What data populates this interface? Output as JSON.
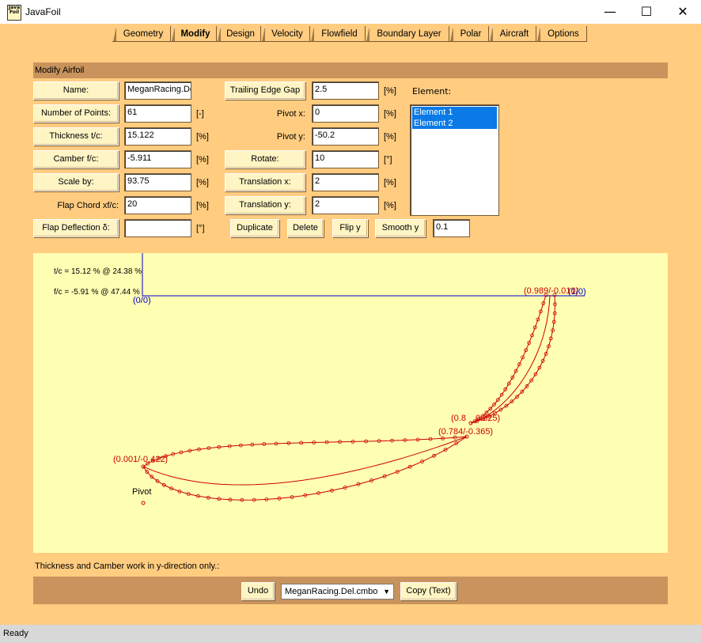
{
  "window": {
    "title": "JavaFoil",
    "icon_text": "Java Foil",
    "minimize": "—",
    "maximize": "☐",
    "close": "✕"
  },
  "tabs": [
    {
      "label": "Geometry",
      "selected": false
    },
    {
      "label": "Modify",
      "selected": true
    },
    {
      "label": "Design",
      "selected": false
    },
    {
      "label": "Velocity",
      "selected": false
    },
    {
      "label": "Flowfield",
      "selected": false
    },
    {
      "label": "Boundary Layer",
      "selected": false
    },
    {
      "label": "Polar",
      "selected": false
    },
    {
      "label": "Aircraft",
      "selected": false
    },
    {
      "label": "Options",
      "selected": false
    }
  ],
  "section": {
    "title": "Modify Airfoil"
  },
  "form": {
    "name": {
      "button": "Name:",
      "value": "MeganRacing.De"
    },
    "points": {
      "button": "Number of Points:",
      "value": "61",
      "unit": "[-]"
    },
    "thickness": {
      "button": "Thickness  t/c:",
      "value": "15.122",
      "unit": "[%]"
    },
    "camber": {
      "button": "Camber  f/c:",
      "value": "-5.911",
      "unit": "[%]"
    },
    "scale": {
      "button": "Scale by:",
      "value": "93.75",
      "unit": "[%]"
    },
    "flap_chord": {
      "label": "Flap Chord    xf/c:",
      "value": "20",
      "unit": "[%]"
    },
    "flap_deflection": {
      "button": "Flap Deflection   δ:",
      "value": "",
      "unit": "[°]"
    },
    "te_gap": {
      "button": "Trailing Edge Gap",
      "value": "2.5",
      "unit": "[%]"
    },
    "pivot_x": {
      "label": "Pivot x:",
      "value": "0",
      "unit": "[%]"
    },
    "pivot_y": {
      "label": "Pivot y:",
      "value": "-50.2",
      "unit": "[%]"
    },
    "rotate": {
      "button": "Rotate:",
      "value": "10",
      "unit": "[°]"
    },
    "translation_x": {
      "button": "Translation x:",
      "value": "2",
      "unit": "[%]"
    },
    "translation_y": {
      "button": "Translation y:",
      "value": "2",
      "unit": "[%]"
    },
    "element_label": "Element:",
    "elements": [
      "Element 1",
      "Element 2"
    ],
    "duplicate": "Duplicate",
    "delete": "Delete",
    "flip_y": "Flip y",
    "smooth_y": "Smooth y",
    "smooth_value": "0.1"
  },
  "plot": {
    "tc_text": "t/c = 15.12 % @ 24.38 %",
    "fc_text": "f/c = -5.91 % @ 47.44 %",
    "origin_label": "(0/0)",
    "unit_label": "(1/0)",
    "labels": {
      "el2_te": "(0.989/-0.010)",
      "el2_le": "(0.8",
      "el2_le_b": "0.325)",
      "el1_te": "(0.784/-0.365)",
      "el1_le": "(0.001/-0.422)",
      "pivot": "Pivot"
    },
    "colors": {
      "axis": "#0000cc",
      "curve": "#cc0000",
      "bg": "#ffffb4"
    }
  },
  "bottom": {
    "note": "Thickness and Camber work in y-direction only.:",
    "undo": "Undo",
    "file": "MeganRacing.Del.cmbo",
    "copy": "Copy (Text)"
  },
  "status": "Ready"
}
